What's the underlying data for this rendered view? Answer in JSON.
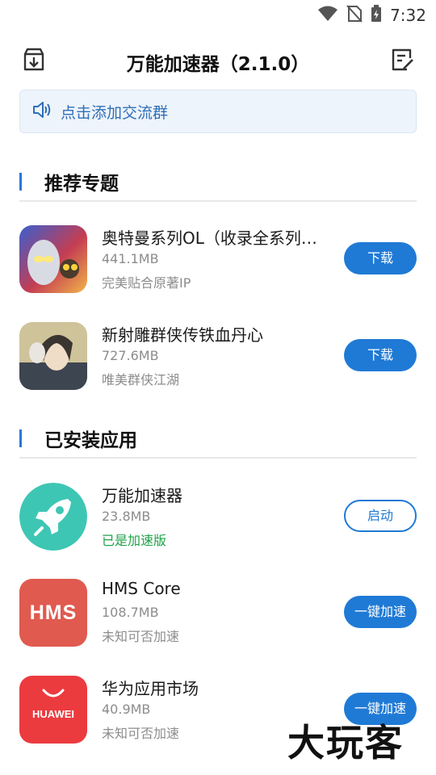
{
  "status_bar": {
    "time": "7:32",
    "icons": [
      "wifi-icon",
      "no-sim-icon",
      "battery-charging-icon"
    ]
  },
  "title_bar": {
    "title": "万能加速器（2.1.0）",
    "left_icon": "download-box-icon",
    "right_icon": "edit-note-icon"
  },
  "notice": {
    "icon": "speaker-icon",
    "text": "点击添加交流群"
  },
  "recommended": {
    "title": "推荐专题",
    "items": [
      {
        "name": "奥特曼系列OL（收录全系列…",
        "size": "441.1MB",
        "desc": "完美贴合原著IP",
        "button": "下载"
      },
      {
        "name": "新射雕群侠传铁血丹心",
        "size": "727.6MB",
        "desc": "唯美群侠江湖",
        "button": "下载"
      }
    ]
  },
  "installed": {
    "title": "已安装应用",
    "items": [
      {
        "name": "万能加速器",
        "size": "23.8MB",
        "desc": "已是加速版",
        "button": "启动",
        "icon_color": "#3ec6b4"
      },
      {
        "name": "HMS Core",
        "size": "108.7MB",
        "desc": "未知可否加速",
        "button": "一键加速",
        "icon_text": "HMS",
        "icon_color": "#e05a4f"
      },
      {
        "name": "华为应用市场",
        "size": "40.9MB",
        "desc": "未知可否加速",
        "button": "一键加速",
        "icon_text": "HUAWEI",
        "icon_color": "#ec3b3f"
      }
    ]
  },
  "watermark": "大玩客"
}
